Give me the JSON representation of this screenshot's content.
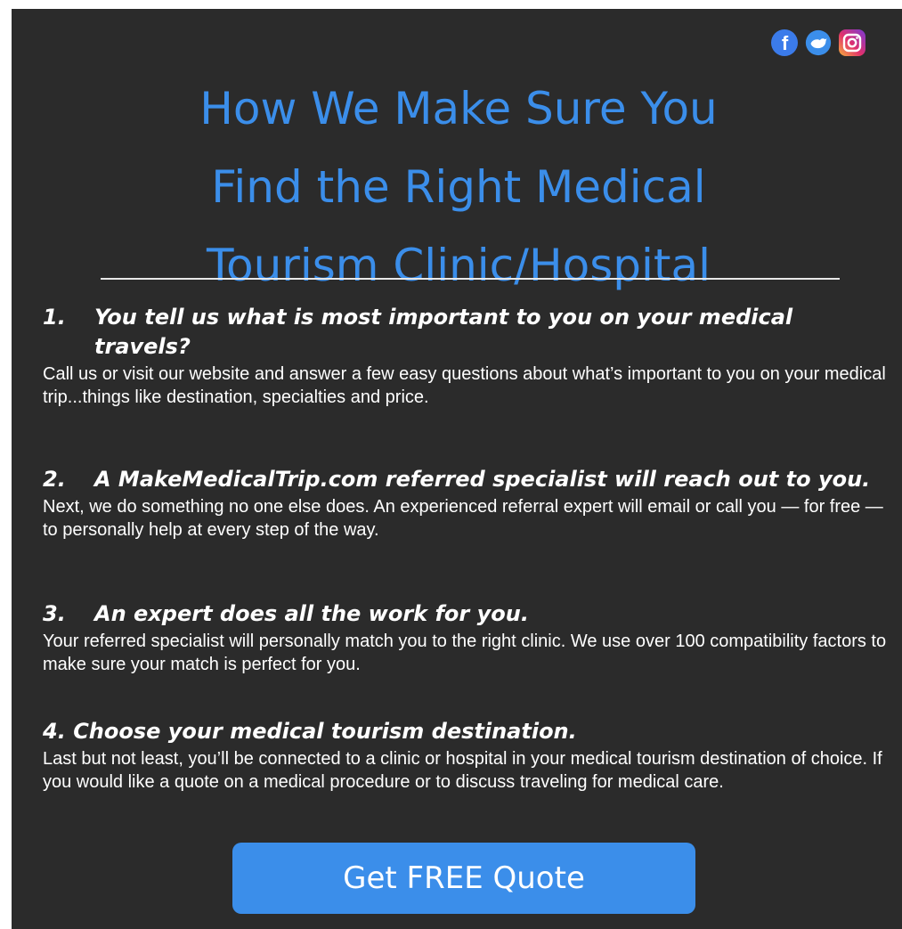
{
  "social": {
    "icons": [
      "facebook-icon",
      "twitter-icon",
      "instagram-icon"
    ]
  },
  "header": {
    "title_line1": "How We Make Sure You",
    "title_line2": "Find the Right Medical",
    "title_line3": "Tourism Clinic/Hospital"
  },
  "steps": [
    {
      "number": "1.",
      "title": "You tell us what is most important to you on your medical travels?",
      "body": "Call us or visit our website and answer a few easy questions about what’s important to you on your medical trip...things like destination, specialties and price."
    },
    {
      "number": "2.",
      "title": "A MakeMedicalTrip.com referred specialist will reach out to you.",
      "body": "Next, we do something no one else does. An experienced referral expert will email or call you — for free — to personally help at every step of the way."
    },
    {
      "number": "3.",
      "title": "An expert does all the work for you.",
      "body": "Your referred specialist will personally match you to the right clinic. We use over 100 compatibility factors to make sure your match is perfect for you."
    },
    {
      "number": "4.",
      "title": "Choose your medical tourism destination.",
      "body": "Last but not least, you’ll be connected to a clinic or hospital in your medical tourism destination of choice. If you would like a quote on a medical procedure or to discuss traveling for medical care."
    }
  ],
  "cta": {
    "label": "Get FREE Quote"
  },
  "colors": {
    "background": "#2b2b2b",
    "accent": "#3b8eea",
    "text": "#ffffff"
  }
}
